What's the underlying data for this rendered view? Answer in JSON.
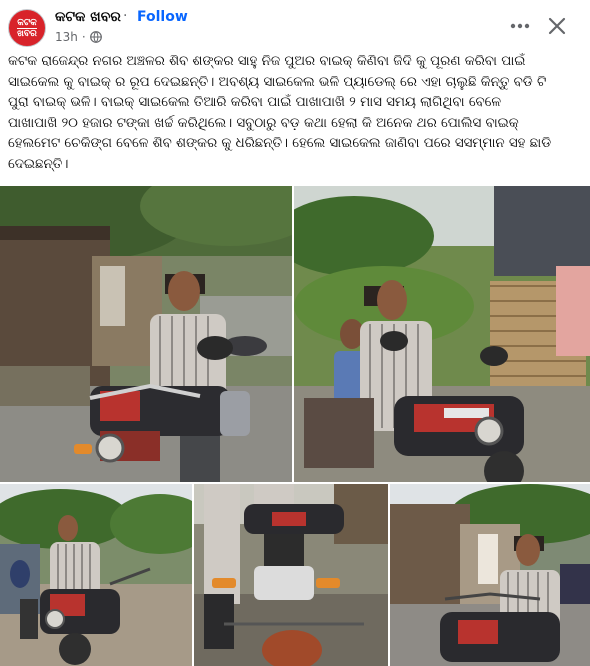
{
  "post": {
    "page_name": "କଟକ ଖବର",
    "follow_label": "Follow",
    "time": "13h",
    "separator": "·",
    "avatar_line1": "କଟକ",
    "avatar_line2": "ଖବର",
    "text": "କଟକ ରାଜେନ୍ଦ୍ର ନଗର ଅଞ୍ଚଳର ଶିବ ଶଙ୍କର ସାହୁ ନିଜ ପୁଅର ବାଇକ୍ କିଣିବା ଜିଦି କୁ ପୂରଣ କରିବା ପାଇଁ\nସାଇକେଲ କୁ ବାଇକ୍ ର ରୂପ ଦେଇଛନ୍ତି। ଅବଶ୍ୟ ସାଇକେଲ ଭଳି ପ୍ୟାଡେଲ୍ ରେ ଏହା ଚାଲୁଛି କିନ୍ତୁ ବଡି ଟି\nପୁରା ବାଇକ୍ ଭଳି। ବାଇକ୍ ସାଇକେଲ ତିଆରି କରିବା ପାଇଁ ପାଖାପାଖି ୨ ମାସ ସମୟ ଲାଗିଥିବା ବେଳେ\nପାଖାପାଖି ୨୦ ହଜାର ଟଙ୍କା ଖର୍ଚ୍ଚ କରିଥିଲେ। ସବୁଠାରୁ ବଡ଼ କଥା ହେଲା କି ଅନେକ ଥର ପୋଲିସ ବାଇକ୍\nହେଲମେଟ ଚେକିଙ୍ଗ ବେଳେ ଶିବ ଶଙ୍କର କୁ ଧରିଛନ୍ତି। ହେଲେ ସାଇକେଲ ଜାଣିବା ପରେ ସସମ୍ମାନ ସହ ଛାଡି\nଦେଇଛନ୍ତି।"
  },
  "icons": {
    "globe": "globe-icon",
    "more": "more-horizontal-icon",
    "close": "close-icon"
  },
  "colors": {
    "link": "#0866ff",
    "secondary_text": "#65676b",
    "avatar_bg": "#d8232a"
  },
  "photos": [
    "man-on-bike-cycle-street",
    "man-and-boy-on-bike-cycle",
    "man-riding-bike-cycle-road",
    "bike-cycle-front-closeup",
    "man-on-bike-cycle-shop"
  ]
}
